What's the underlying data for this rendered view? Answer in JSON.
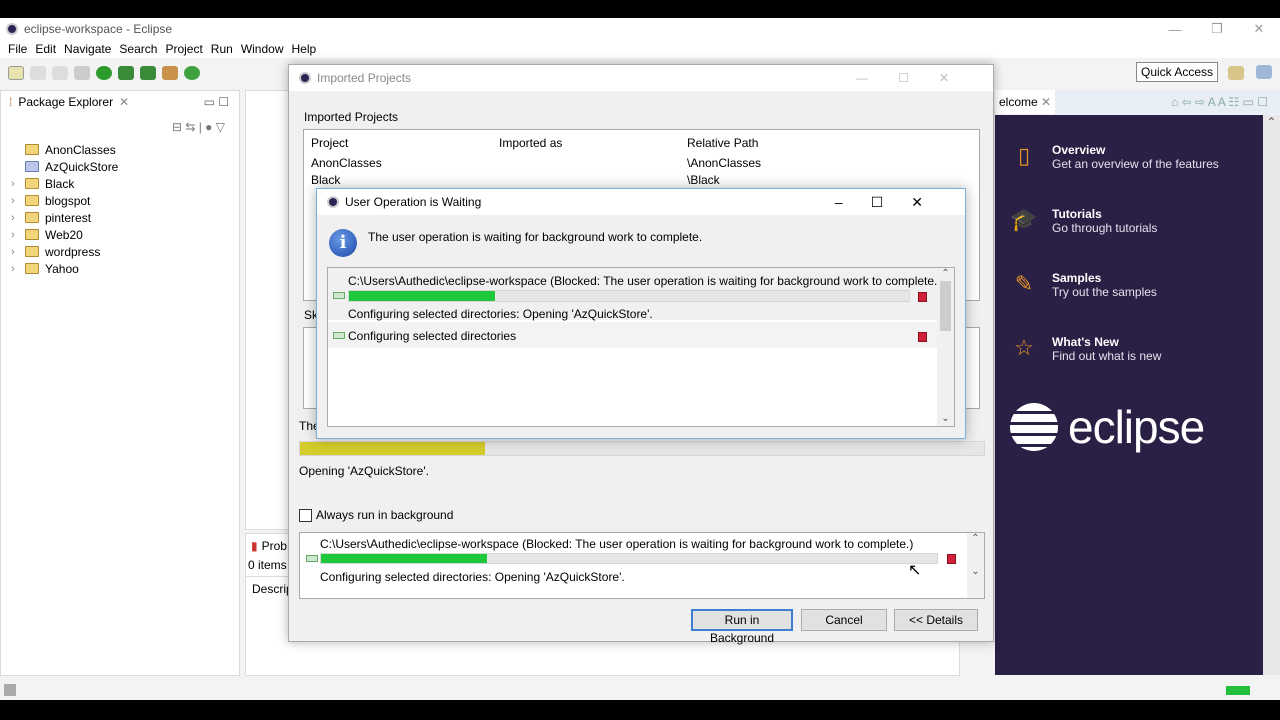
{
  "window": {
    "title": "eclipse-workspace - Eclipse",
    "minimize": "—",
    "restore": "❐",
    "close": "✕"
  },
  "menu": [
    "File",
    "Edit",
    "Navigate",
    "Search",
    "Project",
    "Run",
    "Window",
    "Help"
  ],
  "quick_access": "Quick Access",
  "package_explorer": {
    "title": "Package Explorer",
    "items": [
      {
        "label": "AnonClasses",
        "expandable": false
      },
      {
        "label": "AzQuickStore",
        "expandable": false
      },
      {
        "label": "Black",
        "expandable": true
      },
      {
        "label": "blogspot",
        "expandable": true
      },
      {
        "label": "pinterest",
        "expandable": true
      },
      {
        "label": "Web20",
        "expandable": true
      },
      {
        "label": "wordpress",
        "expandable": true
      },
      {
        "label": "Yahoo",
        "expandable": true
      }
    ]
  },
  "problems": {
    "tab": "Prob",
    "count": "0 items",
    "column": "Descrip"
  },
  "welcome": {
    "tab": "elcome",
    "items": [
      {
        "title": "Overview",
        "desc": "Get an overview of the features",
        "icon": "map-icon"
      },
      {
        "title": "Tutorials",
        "desc": "Go through tutorials",
        "icon": "graduation-cap-icon"
      },
      {
        "title": "Samples",
        "desc": "Try out the samples",
        "icon": "magic-wand-icon"
      },
      {
        "title": "What's New",
        "desc": "Find out what is new",
        "icon": "star-icon"
      }
    ],
    "logo": "eclipse"
  },
  "imported_dialog": {
    "title": "Imported Projects",
    "section": "Imported Projects",
    "columns": [
      "Project",
      "Imported as",
      "Relative Path"
    ],
    "rows": [
      [
        "AnonClasses",
        "",
        "\\AnonClasses"
      ],
      [
        "Black",
        "",
        "\\Black"
      ]
    ],
    "partial_label_sk": "Sk",
    "partial_label_the": "The",
    "progress_percent": 27,
    "progress_color": "#d4cc2a",
    "status": "Opening 'AzQuickStore'.",
    "always_background": "Always run in background",
    "job": {
      "name": "C:\\Users\\Authedic\\eclipse-workspace (Blocked: The user operation is waiting for background work to complete.)",
      "progress_percent": 27,
      "detail": "Configuring selected directories: Opening 'AzQuickStore'."
    },
    "buttons": {
      "run_bg": "Run in Background",
      "cancel": "Cancel",
      "details": "<< Details"
    }
  },
  "wait_dialog": {
    "title": "User Operation is Waiting",
    "message": "The user operation is waiting for background work to complete.",
    "jobs": [
      {
        "name": "C:\\Users\\Authedic\\eclipse-workspace (Blocked: The user operation is waiting for background work to complete.)",
        "progress_percent": 26,
        "detail": "Configuring selected directories: Opening 'AzQuickStore'."
      },
      {
        "name": "Configuring selected directories"
      }
    ]
  },
  "colors": {
    "progress_green": "#1ec83a",
    "welcome_bg": "#2a1f45",
    "accent_orange": "#e39526"
  }
}
